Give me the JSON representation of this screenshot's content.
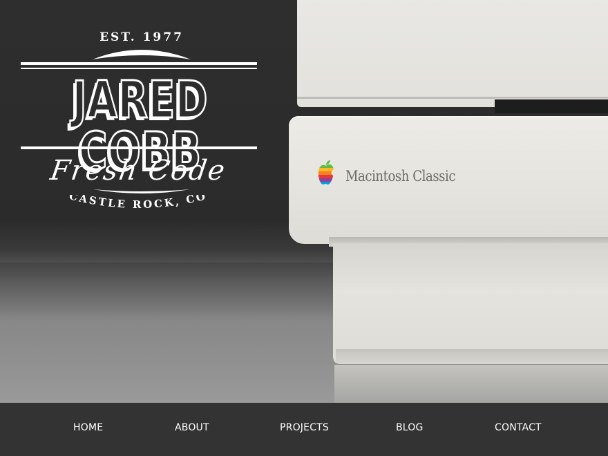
{
  "logo": {
    "est": "EST. 1977",
    "name": "JARED COBB",
    "tagline": "Fresh Code",
    "location": "CASTLE ROCK, CO"
  },
  "hero": {
    "product_label": "Macintosh Classic",
    "icons": [
      "apple-rainbow-logo"
    ]
  },
  "nav": {
    "items": [
      {
        "label": "HOME"
      },
      {
        "label": "ABOUT"
      },
      {
        "label": "PROJECTS"
      },
      {
        "label": "BLOG"
      },
      {
        "label": "CONTACT"
      }
    ]
  },
  "colors": {
    "background_dark": "#2b2b2b",
    "nav_bar": "#333333",
    "nav_text": "#ffffff",
    "logo": "#ffffff",
    "mac_beige": "#e5e4de"
  }
}
